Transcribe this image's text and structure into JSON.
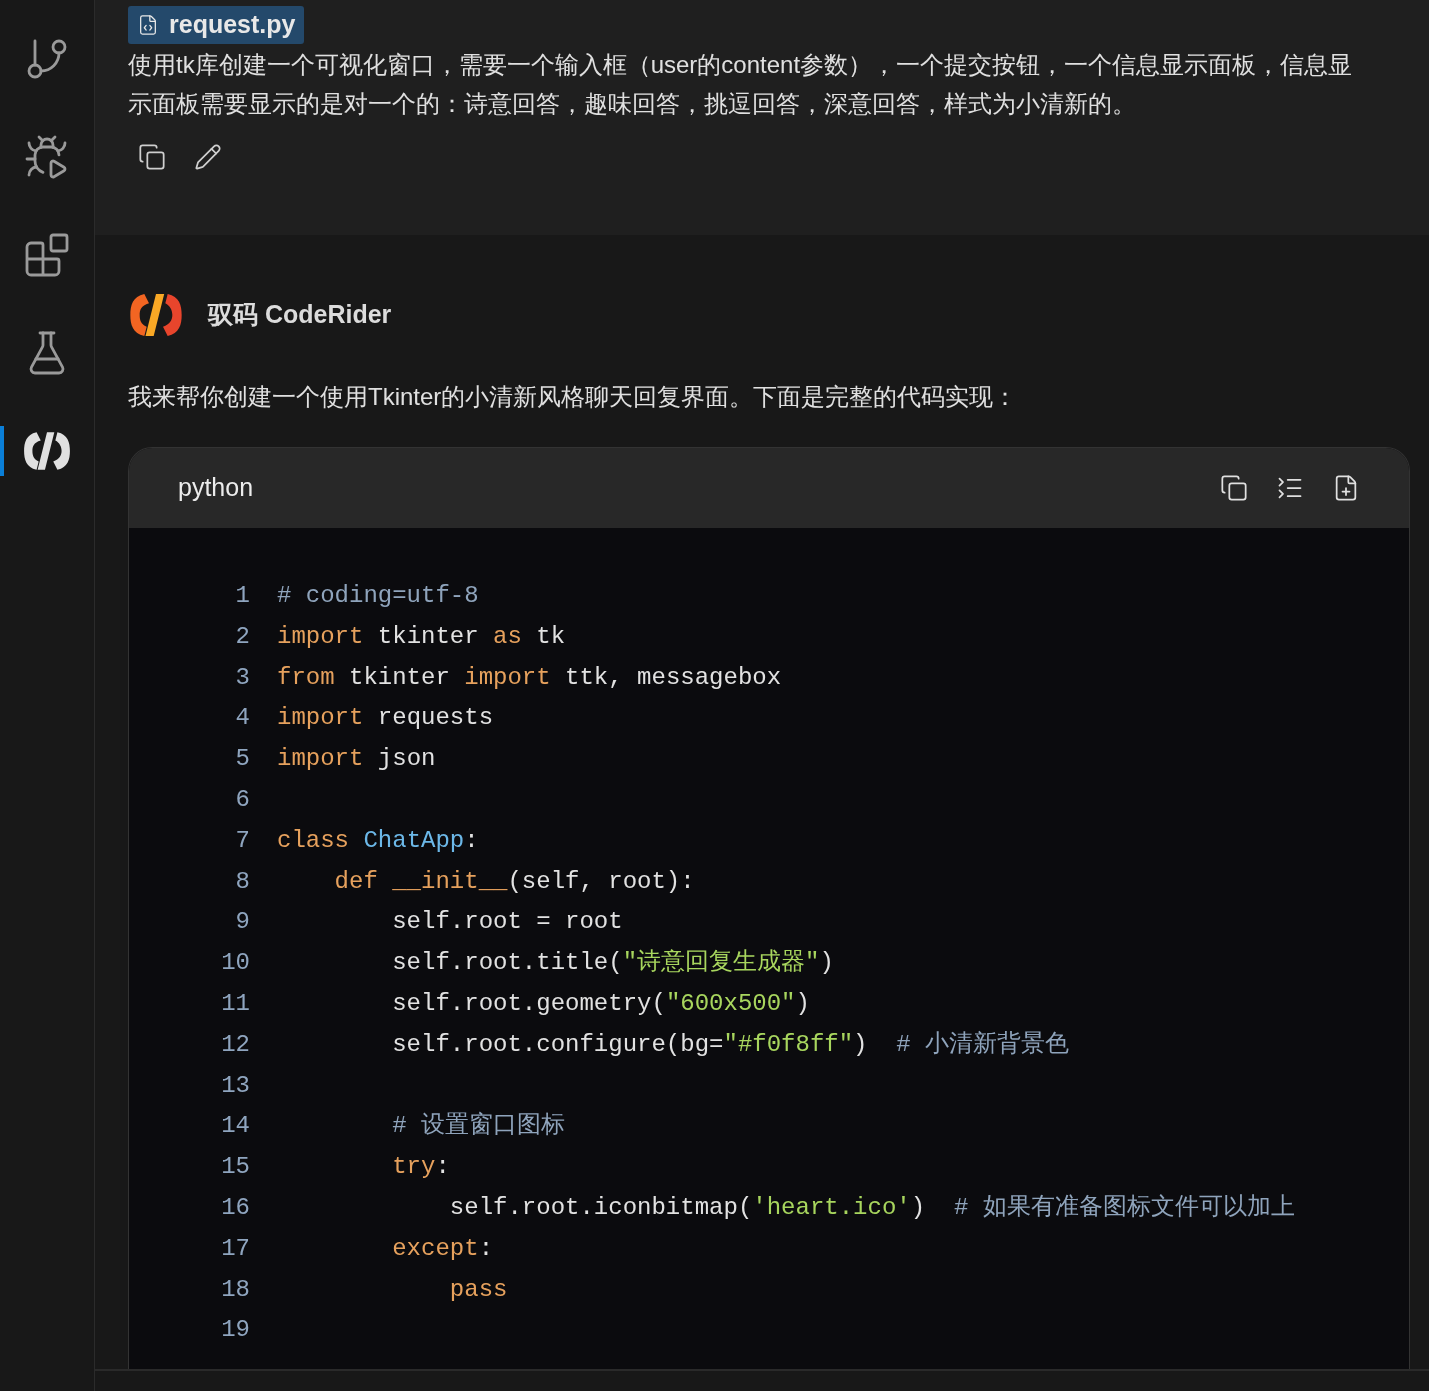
{
  "sidebar": {
    "items": [
      {
        "kind": "source-control",
        "selected": false
      },
      {
        "kind": "run-debug",
        "selected": false
      },
      {
        "kind": "extensions",
        "selected": false
      },
      {
        "kind": "testing",
        "selected": false
      },
      {
        "kind": "assistant",
        "selected": true
      }
    ]
  },
  "user_message": {
    "attachment": "request.py",
    "text": "使用tk库创建一个可视化窗口，需要一个输入框（user的content参数），一个提交按钮，一个信息显示面板，信息显示面板需要显示的是对一个的：诗意回答，趣味回答，挑逗回答，深意回答，样式为小清新的。"
  },
  "assistant_message": {
    "name": "驭码 CodeRider",
    "text": "我来帮你创建一个使用Tkinter的小清新风格聊天回复界面。下面是完整的代码实现：",
    "code_block": {
      "language": "python",
      "lines": [
        {
          "number": "1",
          "tokens": [
            {
              "kind": "comment",
              "text": "# coding=utf-8"
            }
          ]
        },
        {
          "number": "2",
          "tokens": [
            {
              "kind": "keyword",
              "text": "import"
            },
            {
              "kind": "plain",
              "text": " tkinter "
            },
            {
              "kind": "keyword",
              "text": "as"
            },
            {
              "kind": "plain",
              "text": " tk"
            }
          ]
        },
        {
          "number": "3",
          "tokens": [
            {
              "kind": "keyword",
              "text": "from"
            },
            {
              "kind": "plain",
              "text": " tkinter "
            },
            {
              "kind": "keyword",
              "text": "import"
            },
            {
              "kind": "plain",
              "text": " ttk, messagebox"
            }
          ]
        },
        {
          "number": "4",
          "tokens": [
            {
              "kind": "keyword",
              "text": "import"
            },
            {
              "kind": "plain",
              "text": " requests"
            }
          ]
        },
        {
          "number": "5",
          "tokens": [
            {
              "kind": "keyword",
              "text": "import"
            },
            {
              "kind": "plain",
              "text": " json"
            }
          ]
        },
        {
          "number": "6"
        },
        {
          "number": "7",
          "tokens": [
            {
              "kind": "keyword",
              "text": "class "
            },
            {
              "kind": "class",
              "text": "ChatApp"
            },
            {
              "kind": "plain",
              "text": ":"
            }
          ]
        },
        {
          "number": "8",
          "tokens": [
            {
              "kind": "keyword",
              "text": "    def "
            },
            {
              "kind": "function",
              "text": "__init__"
            },
            {
              "kind": "plain",
              "text": "(self, root):"
            }
          ]
        },
        {
          "number": "9",
          "tokens": [
            {
              "kind": "plain",
              "text": "        self.root = root"
            }
          ]
        },
        {
          "number": "10",
          "tokens": [
            {
              "kind": "plain",
              "text": "        self.root.title("
            },
            {
              "kind": "string",
              "text": "\"诗意回复生成器\""
            },
            {
              "kind": "plain",
              "text": ")"
            }
          ]
        },
        {
          "number": "11",
          "tokens": [
            {
              "kind": "plain",
              "text": "        self.root.geometry("
            },
            {
              "kind": "string",
              "text": "\"600x500\""
            },
            {
              "kind": "plain",
              "text": ")"
            }
          ]
        },
        {
          "number": "12",
          "tokens": [
            {
              "kind": "plain",
              "text": "        self.root.configure(bg="
            },
            {
              "kind": "string",
              "text": "\"#f0f8ff\""
            },
            {
              "kind": "plain",
              "text": ")  "
            },
            {
              "kind": "comment",
              "text": "# 小清新背景色"
            }
          ]
        },
        {
          "number": "13"
        },
        {
          "number": "14",
          "tokens": [
            {
              "kind": "comment",
              "text": "        # 设置窗口图标"
            }
          ]
        },
        {
          "number": "15",
          "tokens": [
            {
              "kind": "keyword",
              "text": "        try"
            },
            {
              "kind": "plain",
              "text": ":"
            }
          ]
        },
        {
          "number": "16",
          "tokens": [
            {
              "kind": "plain",
              "text": "            self.root.iconbitmap("
            },
            {
              "kind": "string",
              "text": "'heart.ico'"
            },
            {
              "kind": "plain",
              "text": ")  "
            },
            {
              "kind": "comment",
              "text": "# 如果有准备图标文件可以加上"
            }
          ]
        },
        {
          "number": "17",
          "tokens": [
            {
              "kind": "keyword",
              "text": "        except"
            },
            {
              "kind": "plain",
              "text": ":"
            }
          ]
        },
        {
          "number": "18",
          "tokens": [
            {
              "kind": "keyword",
              "text": "            pass"
            }
          ]
        },
        {
          "number": "19"
        }
      ]
    }
  }
}
